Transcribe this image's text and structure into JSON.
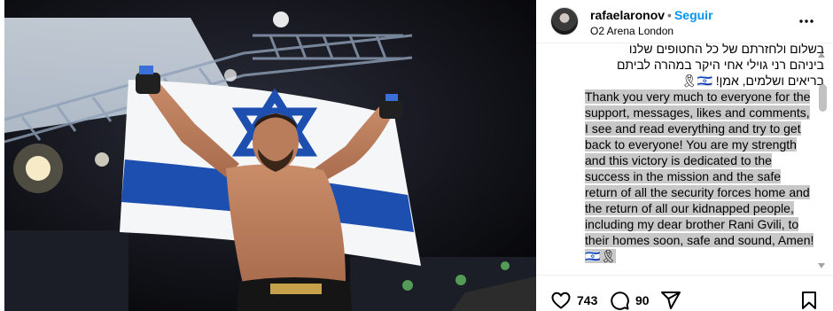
{
  "post": {
    "photo_alt": "Fighter holding Israeli flag in arena",
    "flag_colors": {
      "blue": "#1d4fb0",
      "white": "#f4f6f8"
    }
  },
  "header": {
    "username": "rafaelaronov",
    "separator": "•",
    "follow_label": "Seguir",
    "location": "O2 Arena London",
    "more_icon": "more-horizontal-icon"
  },
  "caption": {
    "hebrew_lines": [
      "בשלום ולחזרתם של כל החטופים שלנו",
      "ביניהם רני גוילי אחי היקר במהרה לביתם",
      "בריאים ושלמים, אמן! 🇮🇱🎗"
    ],
    "english_text": "Thank you very much to everyone for the support, messages, likes and comments, I see and read everything and try to get back to everyone! You are my strength and this victory is dedicated to the success in the mission and the safe return of all the security forces home and the return of all our kidnapped people, including my dear brother Rani Gvili, to their homes soon, safe and sound, Amen! 🇮🇱🎗"
  },
  "actions": {
    "likes_count": "743",
    "comments_count": "90",
    "like_icon": "heart-icon",
    "comment_icon": "comment-icon",
    "share_icon": "share-icon",
    "save_icon": "bookmark-icon"
  },
  "colors": {
    "accent": "#0095f6",
    "highlight": "#c8c8c8"
  }
}
